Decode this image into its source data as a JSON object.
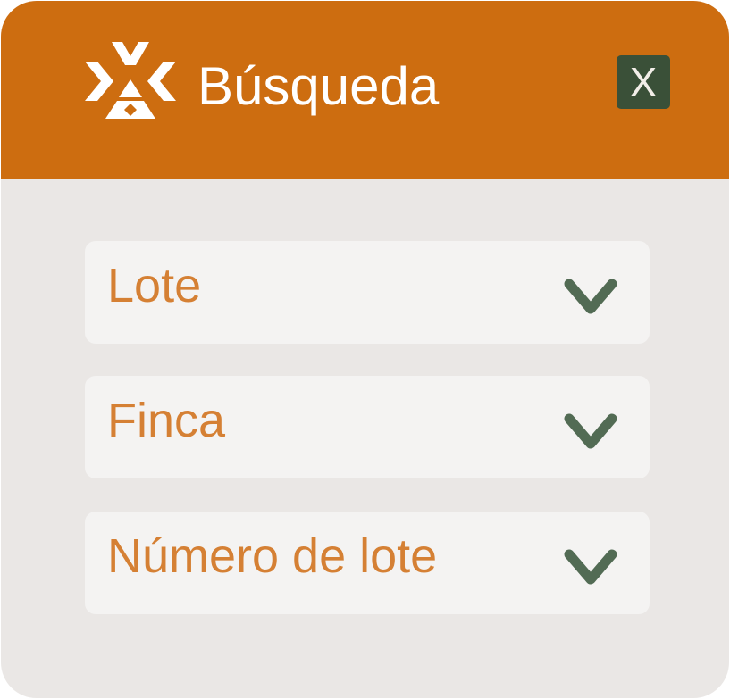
{
  "header": {
    "title": "Búsqueda",
    "close_label": "X",
    "logo_icon": "logo-mark-icon"
  },
  "fields": [
    {
      "label": "Lote",
      "icon": "chevron-down-icon"
    },
    {
      "label": "Finca",
      "icon": "chevron-down-icon"
    },
    {
      "label": "Número de lote",
      "icon": "chevron-down-icon"
    }
  ],
  "colors": {
    "header_bg": "#CD6D10",
    "panel_bg": "#EAE7E5",
    "field_bg": "#F4F3F2",
    "field_text": "#D58034",
    "chevron": "#526B54",
    "close_bg": "#3A5038"
  }
}
